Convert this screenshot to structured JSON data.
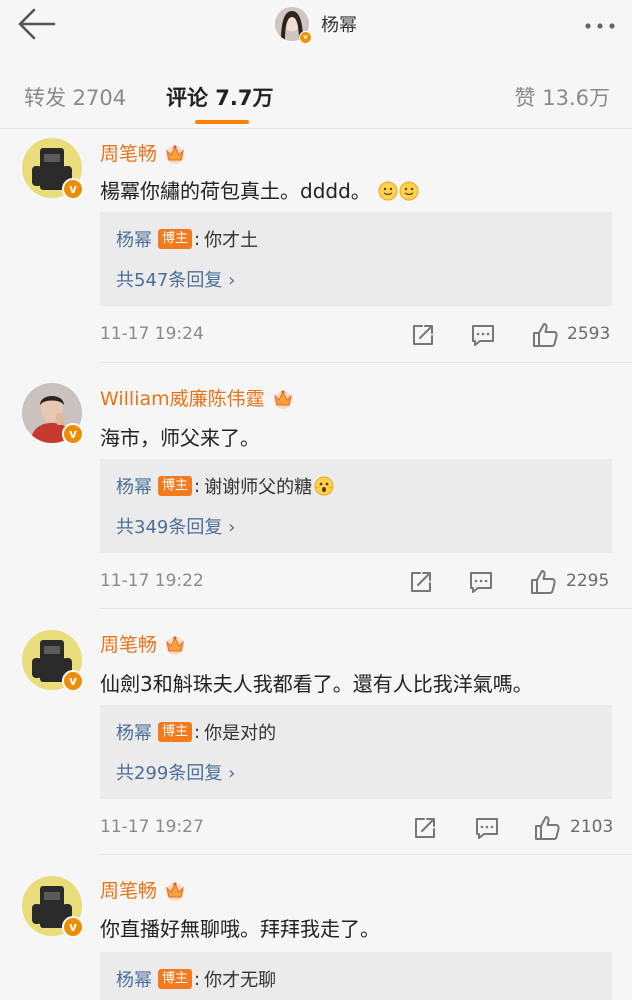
{
  "header": {
    "title": "杨幂"
  },
  "tabs": {
    "forward": "转发 2704",
    "comments": "评论 7.7万",
    "likes": "赞 13.6万"
  },
  "comments": [
    {
      "author": "周笔畅",
      "text": "楊冪你繡的荷包真土。dddd。",
      "reply_author": "杨幂",
      "reply_badge": "博主",
      "reply_colon": ":",
      "reply_text": "你才土",
      "reply_count": "共547条回复 ›",
      "time": "11-17 19:24",
      "likes": "2593"
    },
    {
      "author": "William威廉陈伟霆",
      "text": "海市，师父来了。",
      "reply_author": "杨幂",
      "reply_badge": "博主",
      "reply_colon": ":",
      "reply_text": "谢谢师父的糖",
      "reply_count": "共349条回复 ›",
      "time": "11-17 19:22",
      "likes": "2295"
    },
    {
      "author": "周笔畅",
      "text": "仙劍3和斛珠夫人我都看了。還有人比我洋氣嗎。",
      "reply_author": "杨幂",
      "reply_badge": "博主",
      "reply_colon": ":",
      "reply_text": "你是对的",
      "reply_count": "共299条回复 ›",
      "time": "11-17 19:27",
      "likes": "2103"
    },
    {
      "author": "周笔畅",
      "text": "你直播好無聊哦。拜拜我走了。",
      "reply_author": "杨幂",
      "reply_badge": "博主",
      "reply_colon": ":",
      "reply_text": "你才无聊"
    }
  ],
  "icons": {
    "back": "back-arrow-icon",
    "more": "more-dots-icon",
    "share": "share-icon",
    "comment": "comment-icon",
    "like": "thumbs-up-icon",
    "crown": "crown-icon",
    "verified": "verified-v-icon"
  },
  "colors": {
    "accent": "#ff8200",
    "author": "#e8741a",
    "link": "#4a6f9a",
    "badge": "#f47a20",
    "background": "#f6f6f6",
    "reply_background": "#ebebeb"
  }
}
